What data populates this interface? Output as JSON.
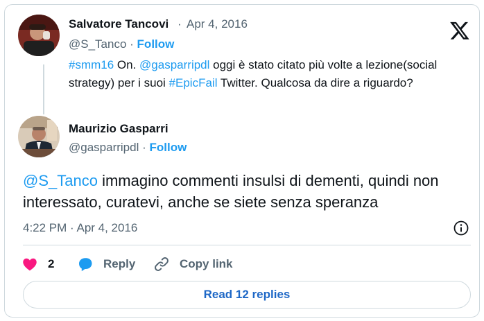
{
  "quoted": {
    "name": "Salvatore Tancovi",
    "dot": "·",
    "date": "Apr 4, 2016",
    "handle": "@S_Tanco",
    "follow": "Follow",
    "text": {
      "hashtag1": "#smm16",
      "part1": " On. ",
      "mention": "@gasparripdl",
      "part2": " oggi è stato citato più volte a lezione(social strategy) per i suoi ",
      "hashtag2": "#EpicFail",
      "part3": " Twitter. Qualcosa da dire a riguardo?"
    }
  },
  "author": {
    "name": "Maurizio Gasparri",
    "handle": "@gasparripdl",
    "follow": "Follow"
  },
  "tweet": {
    "mention": "@S_Tanco",
    "text": " immagino commenti insulsi di dementi, quindi non interessato, curatevi, anche se siete senza speranza",
    "timestamp": "4:22 PM · Apr 4, 2016"
  },
  "actions": {
    "likes": "2",
    "reply": "Reply",
    "copy_link": "Copy link"
  },
  "read_replies": "Read 12 replies",
  "colors": {
    "accent": "#1d9bf0",
    "like": "#f91880",
    "muted": "#536471",
    "border": "#cfd9de"
  },
  "icons": [
    "x-logo-icon",
    "info-icon",
    "heart-icon",
    "reply-bubble-icon",
    "link-icon"
  ]
}
